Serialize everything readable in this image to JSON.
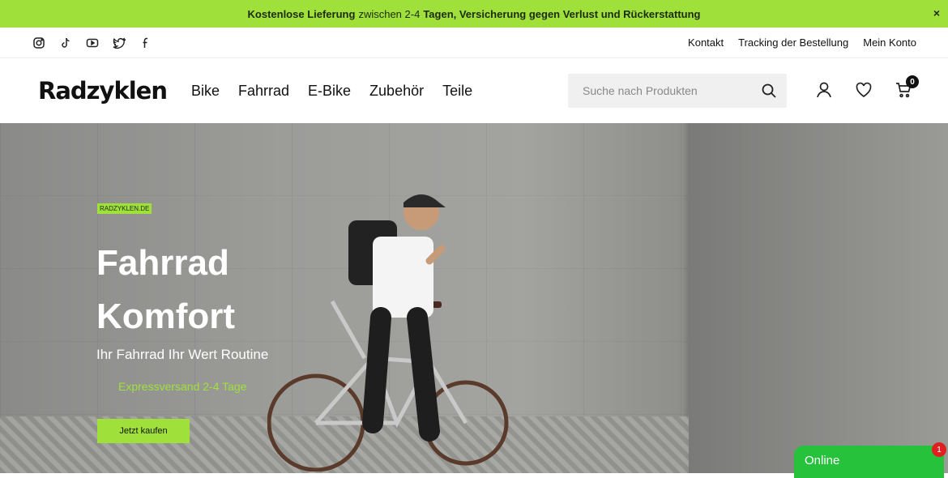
{
  "announcement": {
    "part1": "Kostenlose Lieferung",
    "part2": "zwischen 2-4",
    "part3": "Tagen, Versicherung gegen Verlust und Rückerstattung",
    "close": "×"
  },
  "socials": [
    "instagram-icon",
    "tiktok-icon",
    "youtube-icon",
    "twitter-icon",
    "facebook-icon"
  ],
  "toplinks": {
    "contact": "Kontakt",
    "tracking": "Tracking der Bestellung",
    "account": "Mein Konto"
  },
  "header": {
    "logo": "Radzyklen",
    "nav": [
      "Bike",
      "Fahrrad",
      "E-Bike",
      "Zubehör",
      "Teile"
    ],
    "search_placeholder": "Suche nach Produkten",
    "cart_count": "0"
  },
  "hero": {
    "tag": "RADZYKLEN.DE",
    "title_line1": "Fahrrad",
    "title_line2": "Komfort",
    "subtitle": "Ihr Fahrrad Ihr Wert Routine",
    "express": "Expressversand 2-4 Tage",
    "cta": "Jetzt kaufen"
  },
  "chat": {
    "label": "Online",
    "badge": "1"
  },
  "colors": {
    "accent": "#9fe13a",
    "chat": "#27c23b"
  }
}
